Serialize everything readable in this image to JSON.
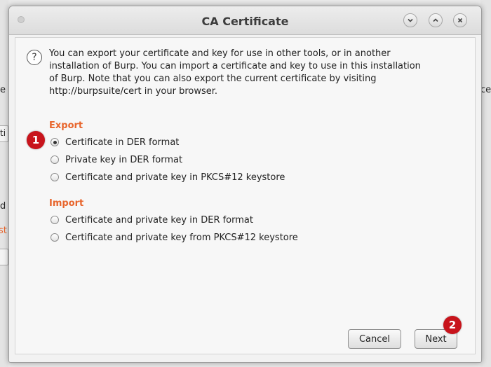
{
  "background": {
    "left_fragments": [
      "e",
      "ti",
      "d",
      "st"
    ],
    "right_fragments": [
      "ce"
    ]
  },
  "dialog": {
    "title": "CA Certificate",
    "window_buttons": [
      "minimize",
      "maximize",
      "close"
    ],
    "info_text": "You can export your certificate and key for use in other tools, or in another\ninstallation of Burp. You can import a certificate and key to use in this installation\nof Burp. Note that you can also export the current certificate by visiting\nhttp://burpsuite/cert in your browser.",
    "export": {
      "title": "Export",
      "options": [
        {
          "label": "Certificate in DER format",
          "checked": true
        },
        {
          "label": "Private key in DER format",
          "checked": false
        },
        {
          "label": "Certificate and private key in PKCS#12 keystore",
          "checked": false
        }
      ]
    },
    "import": {
      "title": "Import",
      "options": [
        {
          "label": "Certificate and private key in DER format",
          "checked": false
        },
        {
          "label": "Certificate and private key from PKCS#12 keystore",
          "checked": false
        }
      ]
    },
    "buttons": {
      "cancel": "Cancel",
      "next": "Next"
    }
  },
  "annotations": {
    "badge_1": "1",
    "badge_2": "2"
  },
  "colors": {
    "accent": "#e8652c",
    "badge": "#c8141c"
  }
}
